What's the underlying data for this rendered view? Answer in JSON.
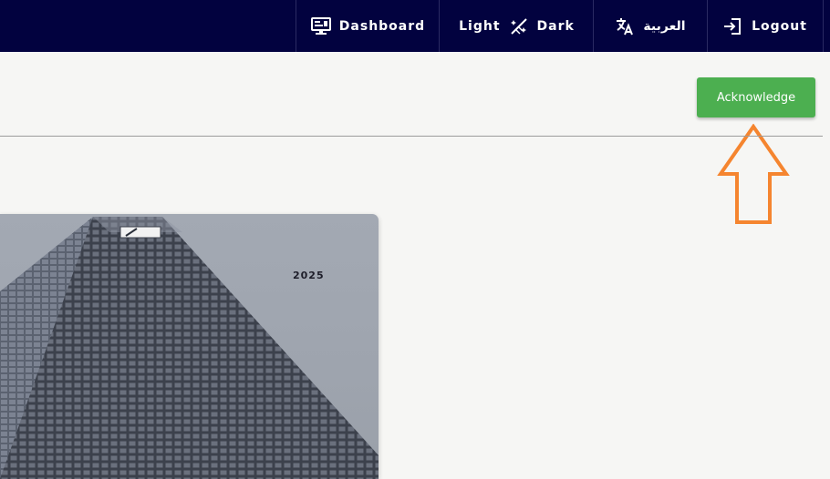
{
  "nav": {
    "dashboard_label": "Dashboard",
    "light_label": "Light",
    "dark_label": "Dark",
    "language_label": "العربية",
    "logout_label": "Logout"
  },
  "icons": {
    "dashboard": "monitor-icon",
    "theme": "theme-toggle-icon",
    "language": "translate-icon",
    "logout": "logout-icon"
  },
  "actions": {
    "acknowledge_label": "Acknowledge"
  },
  "report": {
    "year": "2025"
  },
  "colors": {
    "topbar": "#02023f",
    "acknowledge": "#4caf50",
    "arrow": "#f5852f",
    "background": "#f6f6f4"
  }
}
